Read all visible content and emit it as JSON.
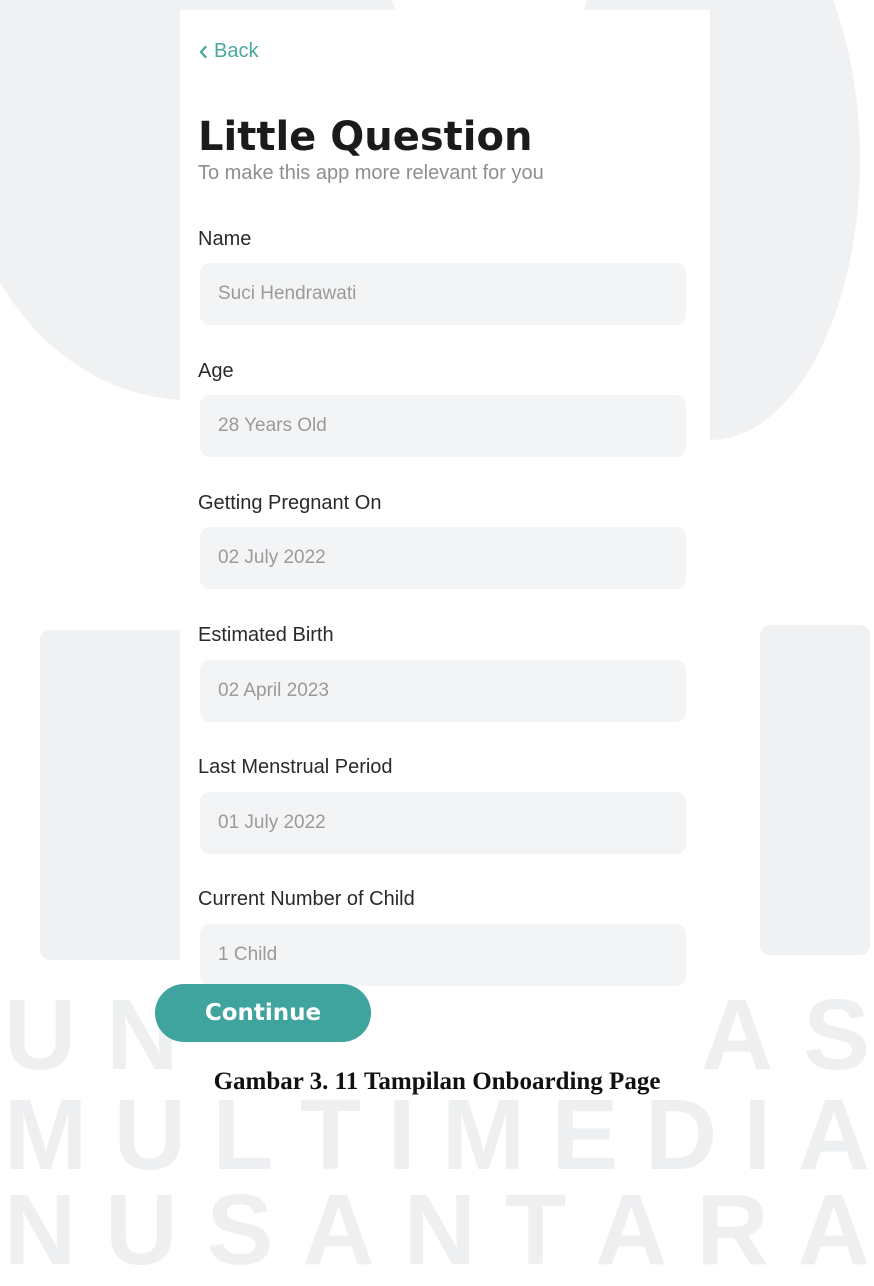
{
  "header": {
    "back_label": "Back",
    "title": "Little Question",
    "subtitle": "To make this app more relevant for you"
  },
  "form": {
    "fields": [
      {
        "label": "Name",
        "value": "Suci Hendrawati"
      },
      {
        "label": "Age",
        "value": "28 Years Old"
      },
      {
        "label": "Getting Pregnant On",
        "value": "02 July 2022"
      },
      {
        "label": "Estimated Birth",
        "value": "02 April 2023"
      },
      {
        "label": "Last Menstrual Period",
        "value": "01 July 2022"
      },
      {
        "label": "Current Number of Child",
        "value": "1 Child"
      }
    ],
    "continue_label": "Continue"
  },
  "caption": "Gambar 3. 11 Tampilan Onboarding Page",
  "watermark": {
    "row1": [
      "U",
      "N",
      "A",
      "S"
    ],
    "row2": [
      "M",
      "U",
      "L",
      "T",
      "I",
      "M",
      "E",
      "D",
      "I",
      "A"
    ],
    "row3": [
      "N",
      "U",
      "S",
      "A",
      "N",
      "T",
      "A",
      "R",
      "A"
    ]
  },
  "colors": {
    "accent": "#4aa89b",
    "button": "#3fa49d",
    "input_bg": "#f2f4f5"
  },
  "icons": {
    "back": "chevron-left-icon"
  }
}
